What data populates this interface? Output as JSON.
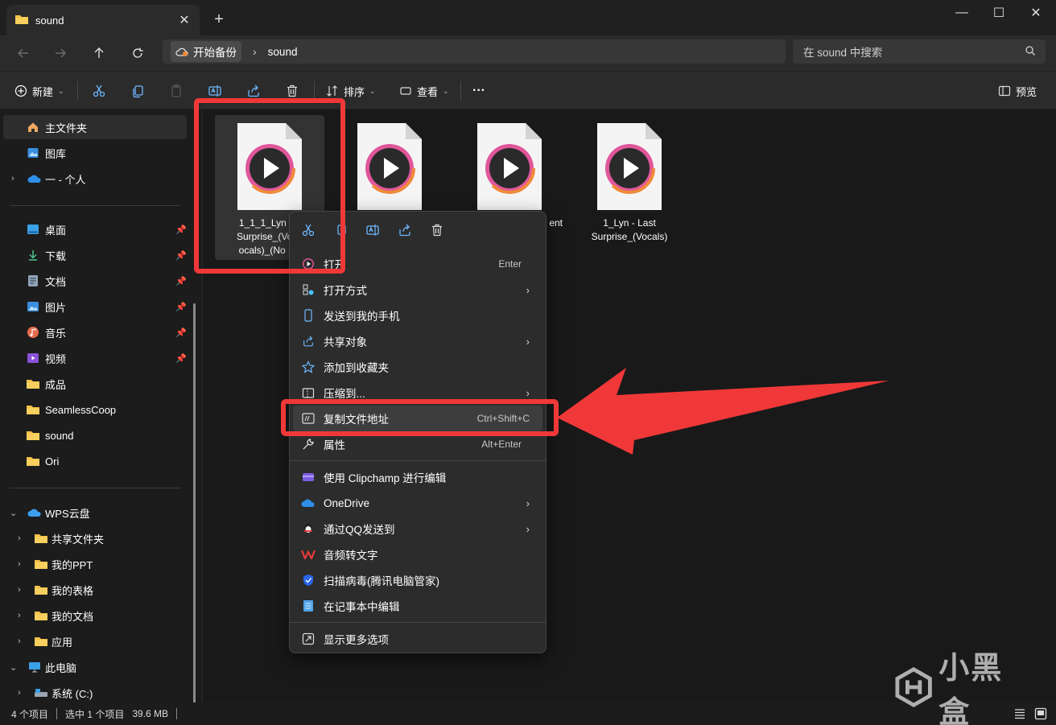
{
  "window": {
    "tab_title": "sound",
    "new_tab": "+",
    "tab_close": "✕",
    "minimize": "—",
    "maximize": "☐",
    "close": "✕"
  },
  "address": {
    "breadcrumb_home": "开始备份",
    "breadcrumb_current": "sound",
    "search_placeholder": "在 sound 中搜索"
  },
  "toolbar": {
    "new_label": "新建",
    "sort_label": "排序",
    "view_label": "查看",
    "more_label": "···",
    "preview_label": "预览"
  },
  "sidebar": {
    "quick": [
      {
        "label": "主文件夹",
        "selected": true
      },
      {
        "label": "图库"
      },
      {
        "label": "一 - 个人"
      }
    ],
    "pinned": [
      {
        "label": "桌面"
      },
      {
        "label": "下载"
      },
      {
        "label": "文档"
      },
      {
        "label": "图片"
      },
      {
        "label": "音乐"
      },
      {
        "label": "视频"
      },
      {
        "label": "成品"
      },
      {
        "label": "SeamlessCoop"
      },
      {
        "label": "sound"
      },
      {
        "label": "Ori"
      }
    ],
    "cloud": {
      "label": "WPS云盘",
      "children": [
        {
          "label": "共享文件夹"
        },
        {
          "label": "我的PPT"
        },
        {
          "label": "我的表格"
        },
        {
          "label": "我的文档"
        },
        {
          "label": "应用"
        }
      ]
    },
    "pc": {
      "label": "此电脑",
      "children": [
        {
          "label": "系统 (C:)"
        }
      ]
    }
  },
  "files": [
    {
      "line1": "1_1_1_Lyn - L",
      "line2": "Surprise_(Voca",
      "line3": "ocals)_(No Re",
      "selected": true
    },
    {
      "line1": "",
      "line2": "",
      "line3": ""
    },
    {
      "line1": "",
      "line2": "ent",
      "line3": ""
    },
    {
      "line1": "1_Lyn - Last",
      "line2": "Surprise_(Vocals)",
      "line3": ""
    }
  ],
  "status": {
    "count": "4 个项目",
    "selection": "选中 1 个项目",
    "size": "39.6 MB"
  },
  "context_menu": {
    "items": [
      {
        "label": "打开",
        "shortcut": "Enter",
        "icon": "play-icon"
      },
      {
        "label": "打开方式",
        "arrow": "›",
        "icon": "open-with-icon"
      },
      {
        "label": "发送到我的手机",
        "icon": "phone-icon"
      },
      {
        "label": "共享对象",
        "arrow": "›",
        "icon": "share-icon"
      },
      {
        "label": "添加到收藏夹",
        "icon": "star-icon"
      },
      {
        "label": "压缩到...",
        "arrow": "›",
        "icon": "zip-icon"
      },
      {
        "label": "复制文件地址",
        "shortcut": "Ctrl+Shift+C",
        "icon": "copy-path-icon"
      },
      {
        "label": "属性",
        "shortcut": "Alt+Enter",
        "icon": "wrench-icon"
      },
      {
        "label": "使用 Clipchamp 进行编辑",
        "icon": "clipchamp-icon"
      },
      {
        "label": "OneDrive",
        "arrow": "›",
        "icon": "onedrive-icon"
      },
      {
        "label": "通过QQ发送到",
        "arrow": "›",
        "icon": "qq-icon"
      },
      {
        "label": "音频转文字",
        "icon": "wps-icon"
      },
      {
        "label": "扫描病毒(腾讯电脑管家)",
        "icon": "shield-icon"
      },
      {
        "label": "在记事本中编辑",
        "icon": "notepad-icon"
      },
      {
        "label": "显示更多选项",
        "icon": "more-options-icon"
      }
    ]
  },
  "watermark": {
    "text": "小黑盒"
  },
  "colors": {
    "annotation_red": "#f03838",
    "folder_yellow": "#f3c14a",
    "accent_blue": "#4cc2ff"
  }
}
